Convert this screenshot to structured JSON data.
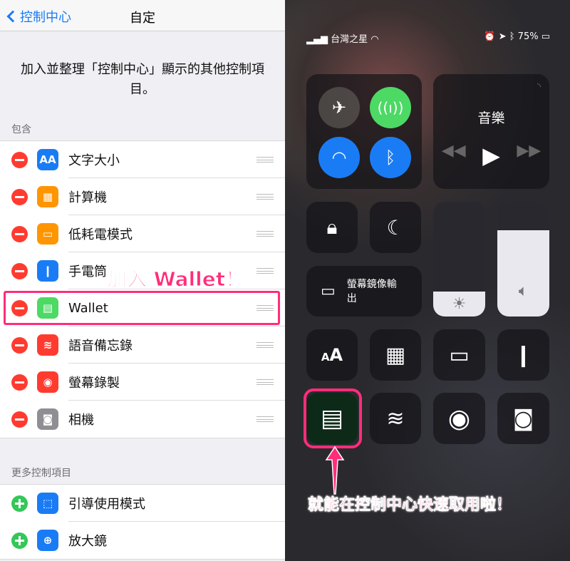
{
  "left": {
    "nav": {
      "back_label": "控制中心",
      "title": "自定"
    },
    "description": "加入並整理「控制中心」顯示的其他控制項目。",
    "included_header": "包含",
    "included": [
      {
        "label": "文字大小",
        "icon": "text-size-icon",
        "color": "#1a7cf5",
        "glyph": "AA"
      },
      {
        "label": "計算機",
        "icon": "calculator-icon",
        "color": "#ff9500",
        "glyph": "▦"
      },
      {
        "label": "低耗電模式",
        "icon": "battery-icon",
        "color": "#ff9500",
        "glyph": "▭"
      },
      {
        "label": "手電筒",
        "icon": "flashlight-icon",
        "color": "#1a7cf5",
        "glyph": "❙"
      },
      {
        "label": "Wallet",
        "icon": "wallet-icon",
        "color": "#4cd964",
        "glyph": "▤"
      },
      {
        "label": "語音備忘錄",
        "icon": "voice-memo-icon",
        "color": "#ff3b30",
        "glyph": "≋"
      },
      {
        "label": "螢幕錄製",
        "icon": "screen-record-icon",
        "color": "#ff3b30",
        "glyph": "◉"
      },
      {
        "label": "相機",
        "icon": "camera-icon",
        "color": "#8e8e93",
        "glyph": "◙"
      }
    ],
    "more_header": "更多控制項目",
    "more": [
      {
        "label": "引導使用模式",
        "icon": "guided-access-icon",
        "color": "#1a7cf5",
        "glyph": "⬚"
      },
      {
        "label": "放大鏡",
        "icon": "magnifier-icon",
        "color": "#1a7cf5",
        "glyph": "⊕"
      }
    ],
    "annotation": "加入 Wallet！"
  },
  "right": {
    "status": {
      "carrier": "台灣之星",
      "battery": "75%"
    },
    "music_title": "音樂",
    "screen_mirroring": "螢幕鏡像輸出",
    "brightness_level": 0.22,
    "volume_level": 0.75,
    "annotation": "就能在控制中心快速取用啦！",
    "colors": {
      "cellular": "#4cd964",
      "wifi": "#1a7cf5",
      "bluetooth": "#1a7cf5",
      "highlight": "#ff2d7a"
    }
  }
}
